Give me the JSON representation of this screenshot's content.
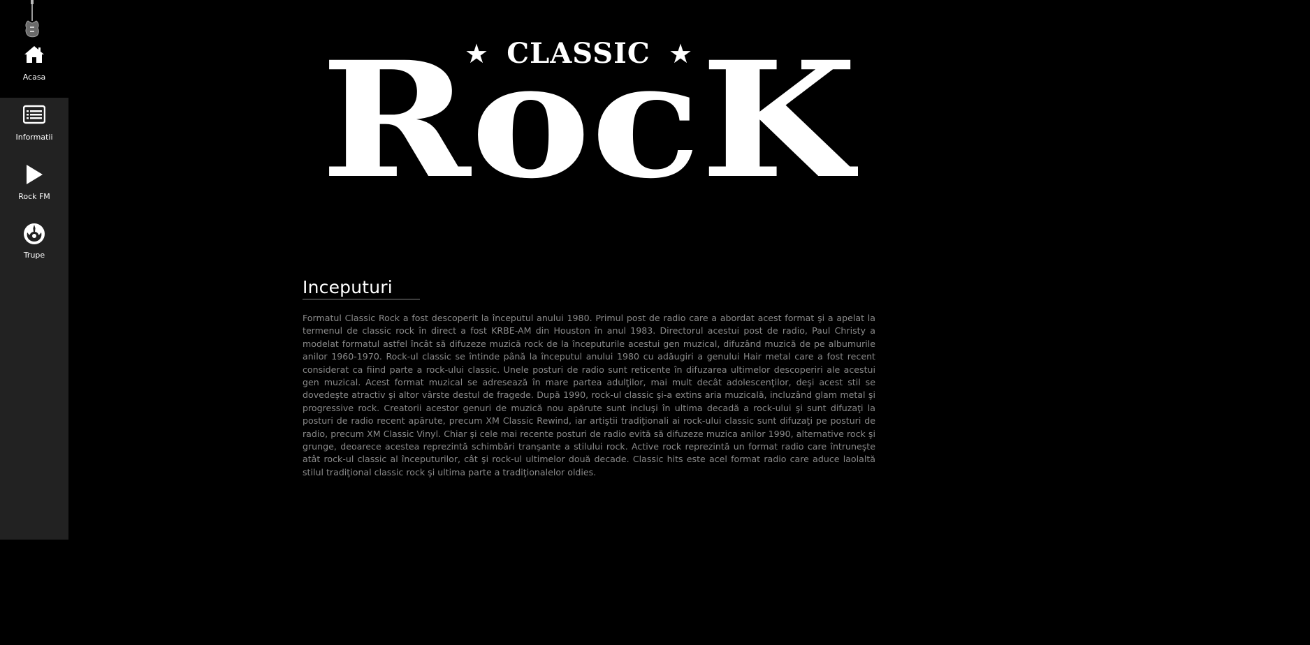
{
  "sidebar": {
    "logo": {
      "icon": "electric-guitar-icon"
    },
    "items": [
      {
        "label": "Acasa",
        "icon": "home-icon"
      },
      {
        "label": "Informatii",
        "icon": "list-icon"
      },
      {
        "label": "Rock FM",
        "icon": "play-icon"
      },
      {
        "label": "Trupe",
        "icon": "rebel-alliance-icon"
      }
    ]
  },
  "hero": {
    "logo_small_text": "CLASSIC",
    "logo_large_text": "RocK",
    "logo_star": "★"
  },
  "main": {
    "section_title": "Inceputuri",
    "paragraph": "Formatul Classic Rock a fost descoperit la începutul anului 1980. Primul post de radio care a abordat acest format şi a apelat la termenul de classic rock în direct a fost KRBE-AM din Houston în anul 1983. Directorul acestui post de radio, Paul Christy a modelat formatul astfel încât să difuzeze muzică rock de la începuturile acestui gen muzical, difuzând muzică de pe albumurile anilor 1960-1970. Rock-ul classic se întinde până la începutul anului 1980 cu adăugiri a genului Hair metal care a fost recent considerat ca fiind parte a rock-ului classic. Unele posturi de radio sunt reticente în difuzarea ultimelor descoperiri ale acestui gen muzical. Acest format muzical se adresează în mare partea adulţilor, mai mult decât adolescenţilor, deşi acest stil se dovedeşte atractiv şi altor vârste destul de fragede. După 1990, rock-ul classic şi-a extins aria muzicală, incluzând glam metal şi progressive rock. Creatorii acestor genuri de muzică nou apărute sunt incluşi în ultima decadă a rock-ului şi sunt difuzaţi la posturi de radio recent apărute, precum XM Classic Rewind, iar artiştii tradiţionali ai rock-ului classic sunt difuzaţi pe posturi de radio, precum XM Classic Vinyl. Chiar şi cele mai recente posturi de radio evită să difuzeze muzica anilor 1990, alternative rock şi grunge, deoarece acestea reprezintă schimbări tranşante a stilului rock. Active rock reprezintă un format radio care întruneşte atât rock-ul classic al începuturilor, cât şi rock-ul ultimelor două decade. Classic hits este acel format radio care aduce laolaltă stilul tradiţional classic rock şi ultima parte a tradiţionalelor oldies."
  },
  "colors": {
    "background": "#000000",
    "sidebar": "#222222",
    "text": "#ffffff",
    "body_text": "#8a8a8a"
  }
}
